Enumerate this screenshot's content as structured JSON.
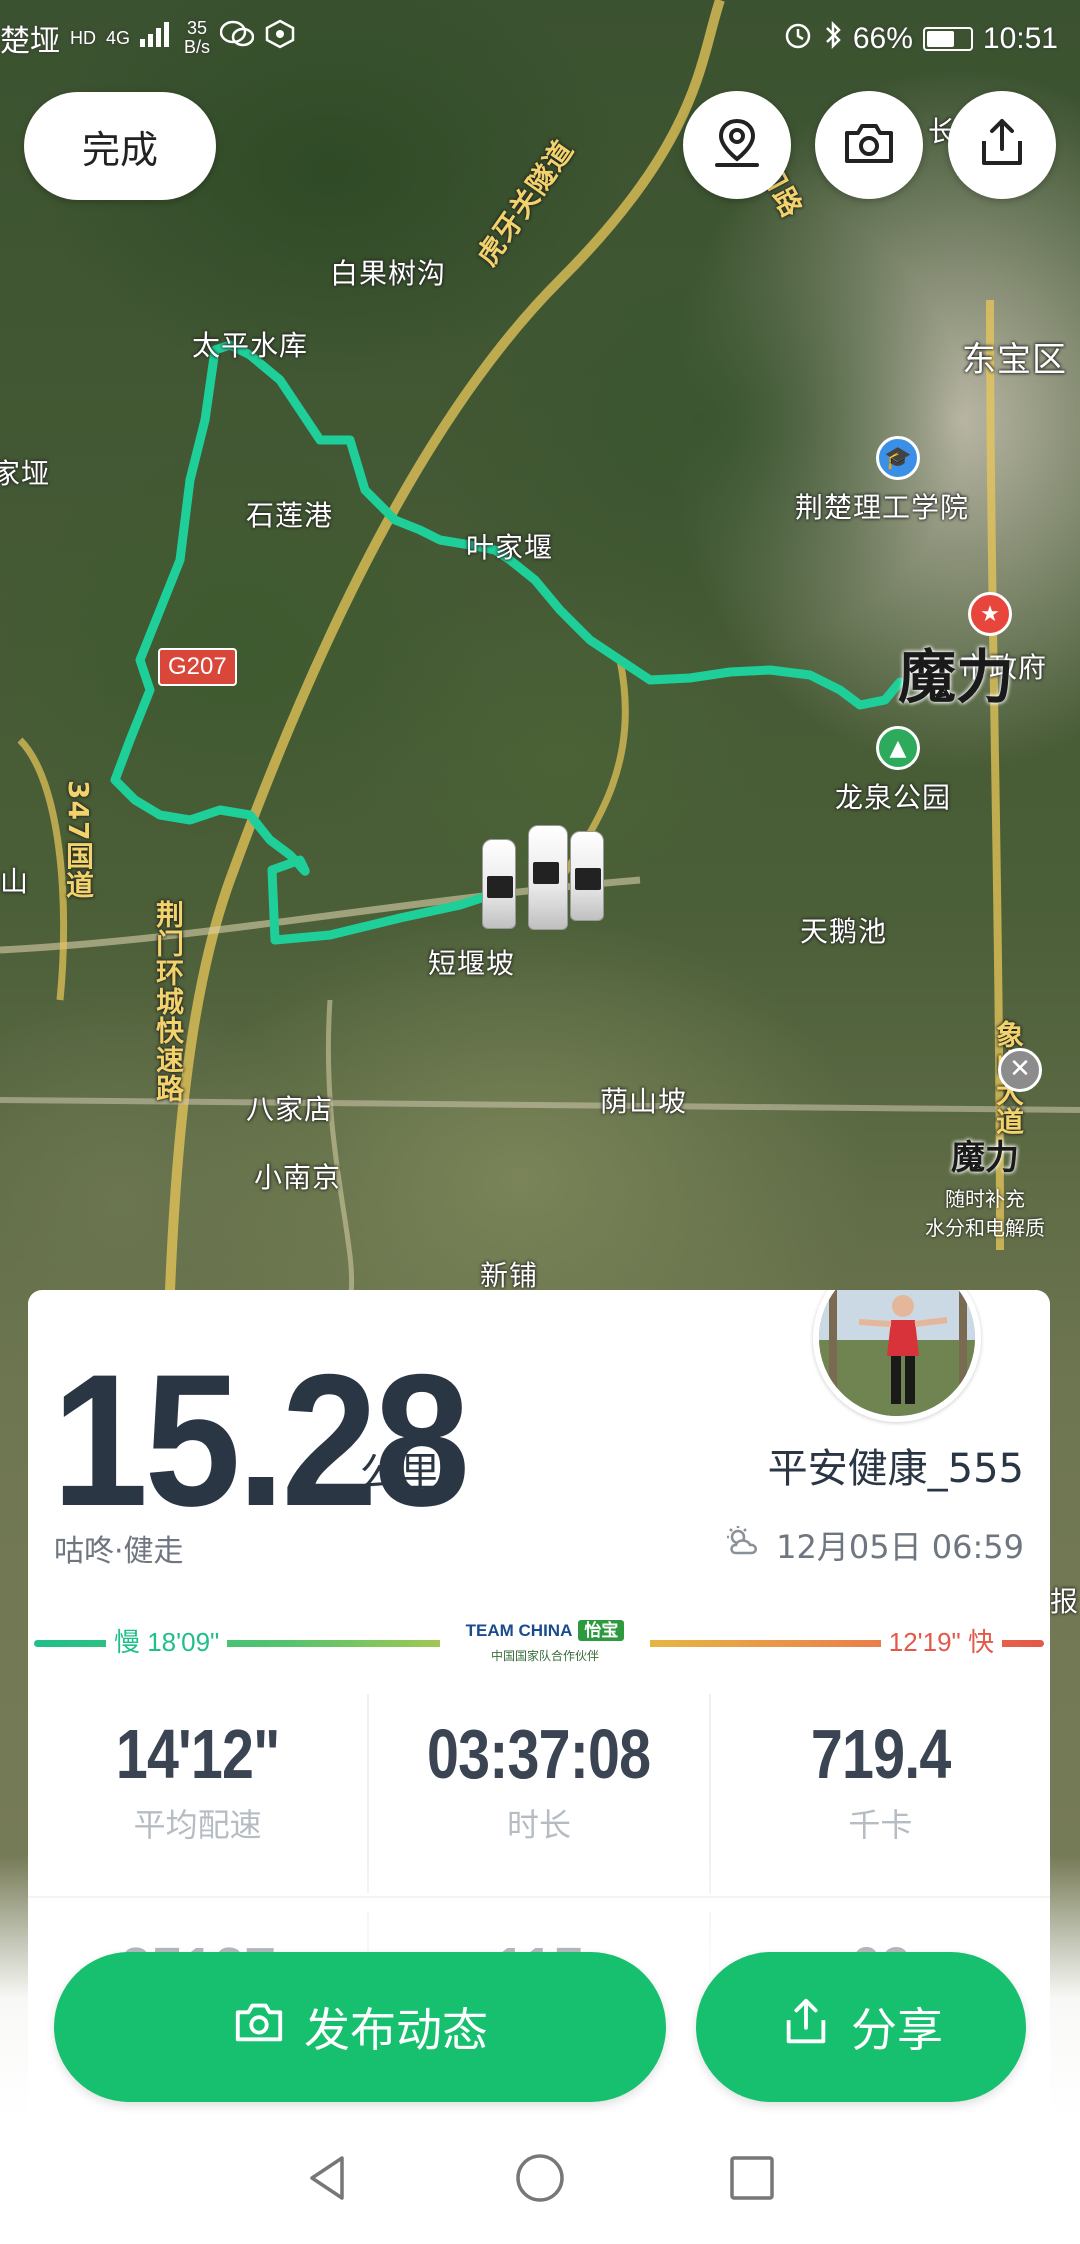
{
  "status_bar": {
    "carrier": "楚垭",
    "network_hd": "HD",
    "network_gen": "4G",
    "speed_value": "35",
    "speed_unit": "B/s",
    "battery_percent": "66%",
    "battery_level": 0.66,
    "time": "10:51"
  },
  "top_bar": {
    "done_label": "完成",
    "icons": [
      "location-pin-icon",
      "camera-icon",
      "share-icon"
    ]
  },
  "map": {
    "labels": {
      "baiguoshugou": "白果树沟",
      "taipingshuiku": "太平水库",
      "jiayan": "家垭",
      "shilianggang": "石莲港",
      "yejiayan": "叶家堰",
      "duanyanpo": "短堰坡",
      "tianechi": "天鹅池",
      "bajiadian": "八家店",
      "xiaonanjing": "小南京",
      "yinshanpo": "荫山坡",
      "xinpu": "新铺",
      "dongbaoqu": "东宝区",
      "university": "荆楚理工学院",
      "government": "市政府",
      "longquan_park": "龙泉公园",
      "tunnel": "虎牙关隧道",
      "road_g207": "G207",
      "road_347": "347国道",
      "ring_road": "荆门环城快速路",
      "xiang_avenue": "象山大道",
      "kou_road": "口路",
      "zhang": "长",
      "shan": "山",
      "bao": "报"
    },
    "ad": {
      "brand": "魔力",
      "tagline_1": "随时补充",
      "tagline_2": "水分和电解质"
    },
    "route_color": "#1fcf9a"
  },
  "summary": {
    "distance": "15.28",
    "distance_unit": "公里",
    "username": "平安健康_555",
    "sport_type": "咕咚·健走",
    "datetime": "12月05日 06:59",
    "weather_icon": "partly-cloudy-icon",
    "pace_slow_label": "慢 18'09\"",
    "pace_fast_label": "12'19\" 快",
    "sponsor_brand": "TEAM CHINA",
    "sponsor_partner": "怡宝",
    "sponsor_caption": "中国国家队合作伙伴",
    "stats": [
      {
        "value": "14'12\"",
        "label": "平均配速"
      },
      {
        "value": "03:37:08",
        "label": "时长"
      },
      {
        "value": "719.4",
        "label": "千卡"
      }
    ],
    "stats_second_row_partial": [
      "25127",
      "115",
      "69"
    ]
  },
  "actions": {
    "publish_label": "发布动态",
    "share_label": "分享"
  },
  "colors": {
    "accent_green": "#16c06e",
    "text_dark": "#2b3645",
    "pace_slow": "#1fbf8a",
    "pace_fast": "#e4584a"
  }
}
